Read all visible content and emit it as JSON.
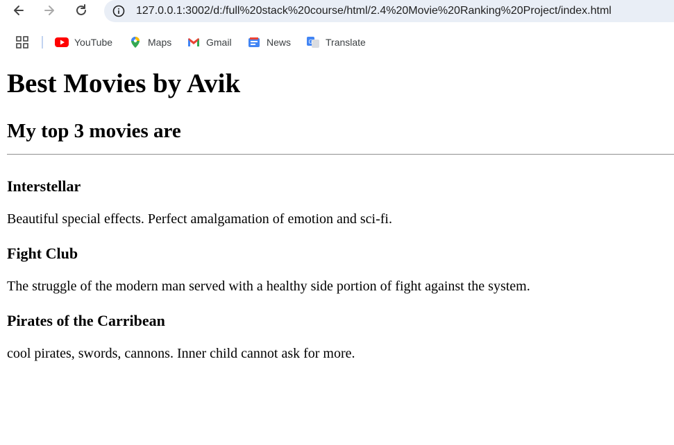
{
  "browser": {
    "url": "127.0.0.1:3002/d:/full%20stack%20course/html/2.4%20Movie%20Ranking%20Project/index.html",
    "bookmarks": [
      {
        "label": "YouTube",
        "icon": "youtube-icon"
      },
      {
        "label": "Maps",
        "icon": "maps-icon"
      },
      {
        "label": "Gmail",
        "icon": "gmail-icon"
      },
      {
        "label": "News",
        "icon": "news-icon"
      },
      {
        "label": "Translate",
        "icon": "translate-icon"
      }
    ]
  },
  "page": {
    "title": "Best Movies by Avik",
    "subtitle": "My top 3 movies are",
    "movies": [
      {
        "title": "Interstellar",
        "description": "Beautiful special effects. Perfect amalgamation of emotion and sci-fi."
      },
      {
        "title": "Fight Club",
        "description": "The struggle of the modern man served with a healthy side portion of fight against the system."
      },
      {
        "title": "Pirates of the Carribean",
        "description": "cool pirates, swords, cannons. Inner child cannot ask for more."
      }
    ]
  },
  "colors": {
    "omnibox_bg": "#e9eef6",
    "youtube_red": "#ff0000",
    "divider": "#999999"
  }
}
